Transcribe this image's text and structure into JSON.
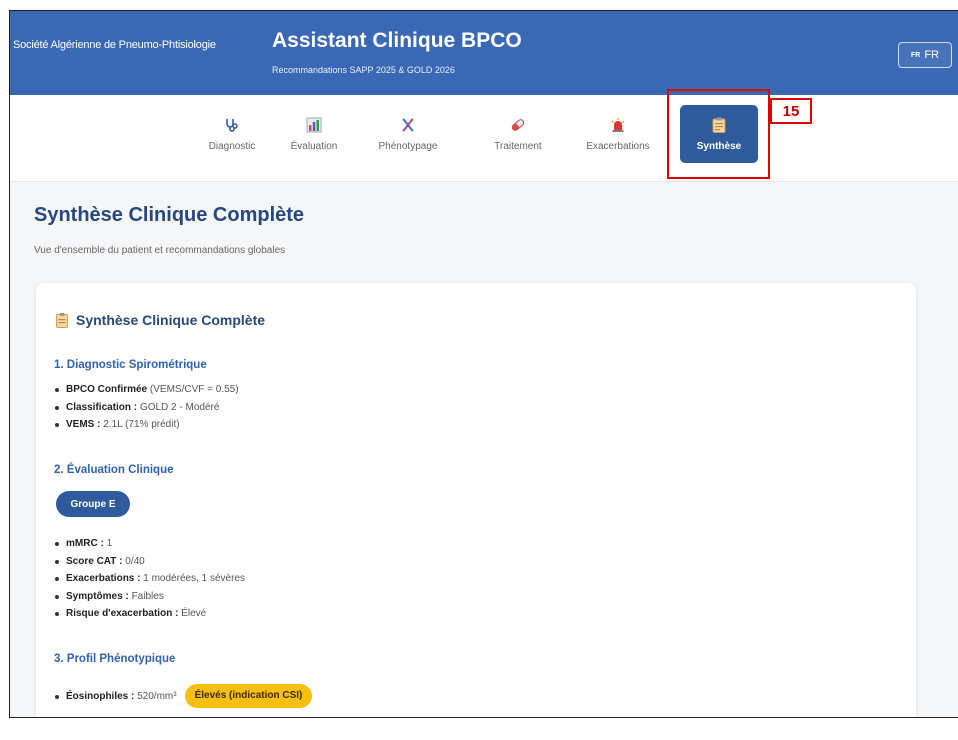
{
  "header": {
    "org": "Société Algérienne de Pneumo-Phtisiologie",
    "title": "Assistant Clinique BPCO",
    "subtitle": "Recommandations SAPP 2025 & GOLD 2026",
    "lang_flag": "FR",
    "lang_label": "FR"
  },
  "tabs": [
    {
      "label": "Diagnostic",
      "icon": "stethoscope-icon"
    },
    {
      "label": "Évaluation",
      "icon": "bar-chart-icon"
    },
    {
      "label": "Phénotypage",
      "icon": "dna-icon"
    },
    {
      "label": "Traitement",
      "icon": "pill-icon"
    },
    {
      "label": "Exacerbations",
      "icon": "siren-icon"
    },
    {
      "label": "Synthèse",
      "icon": "clipboard-icon",
      "active": true
    }
  ],
  "annotation": {
    "number": "15",
    "color": "#e00000"
  },
  "page": {
    "title": "Synthèse Clinique Complète",
    "subtitle": "Vue d'ensemble du patient et recommandations globales"
  },
  "card": {
    "title": "Synthèse Clinique Complète",
    "sections": {
      "diagnostic": {
        "title": "1. Diagnostic Spirométrique",
        "items": [
          {
            "label": "BPCO Confirmée",
            "value": "(VEMS/CVF = 0.55)"
          },
          {
            "label": "Classification :",
            "value": "GOLD 2 - Modéré"
          },
          {
            "label": "VEMS :",
            "value": "2.1L (71% prédit)"
          }
        ]
      },
      "evaluation": {
        "title": "2. Évaluation Clinique",
        "group_badge": "Groupe E",
        "items": [
          {
            "label": "mMRC :",
            "value": "1"
          },
          {
            "label": "Score CAT :",
            "value": "0/40"
          },
          {
            "label": "Exacerbations :",
            "value": "1 modérées, 1 sévères"
          },
          {
            "label": "Symptômes :",
            "value": "Faibles"
          },
          {
            "label": "Risque d'exacerbation :",
            "value": "Élevé"
          }
        ]
      },
      "phenotype": {
        "title": "3. Profil Phénotypique",
        "items": [
          {
            "label": "Éosinophiles :",
            "value": "520/mm³",
            "badge": "Élevés (indication CSI)"
          }
        ]
      }
    }
  },
  "colors": {
    "header_bg": "#3a68b4",
    "primary": "#2f5b9c",
    "title": "#26487e",
    "section": "#2f63b0",
    "badge_yellow": "#f7c010"
  }
}
